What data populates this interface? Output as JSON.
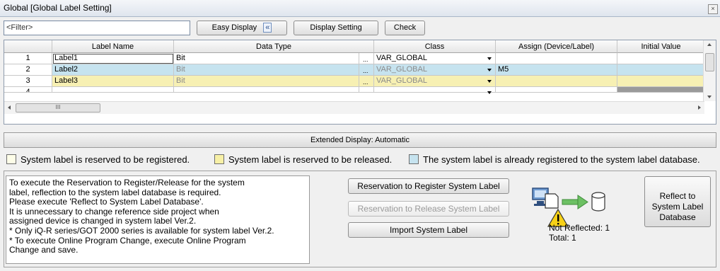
{
  "window": {
    "title": "Global [Global Label Setting]",
    "close_glyph": "×"
  },
  "toolbar": {
    "filter_placeholder": "<Filter>",
    "easy_display_label": "Easy Display",
    "easy_display_icon": "«",
    "display_setting_label": "Display Setting",
    "check_label": "Check"
  },
  "table": {
    "columns": [
      "Label Name",
      "Data Type",
      "Class",
      "Assign (Device/Label)",
      "Initial Value"
    ],
    "rows": [
      {
        "num": "1",
        "label": "Label1",
        "datatype": "Bit",
        "ellipsis": "...",
        "class": "VAR_GLOBAL",
        "assign": "",
        "initial": "",
        "color": "#ffffff",
        "dim": false
      },
      {
        "num": "2",
        "label": "Label2",
        "datatype": "Bit",
        "ellipsis": "...",
        "class": "VAR_GLOBAL",
        "assign": "M5",
        "initial": "",
        "color": "#c6e3ef",
        "dim": true
      },
      {
        "num": "3",
        "label": "Label3",
        "datatype": "Bit",
        "ellipsis": "...",
        "class": "VAR_GLOBAL",
        "assign": "",
        "initial": "",
        "color": "#f7f0b3",
        "dim": true
      },
      {
        "num": "4",
        "label": "",
        "datatype": "",
        "ellipsis": "",
        "class": "",
        "assign": "",
        "initial": "",
        "color": "#ffffff",
        "dim": false
      }
    ],
    "hscroll_thumb_glyph": "III"
  },
  "extended_display": "Extended Display: Automatic",
  "legend": {
    "reserved_register": {
      "text": "System label is reserved to be registered.",
      "color": "#fdfde8"
    },
    "reserved_release": {
      "text": "System label is reserved to be released.",
      "color": "#f7f0a6"
    },
    "registered": {
      "text": "The system label is already registered to the system label database.",
      "color": "#c6e3ef"
    }
  },
  "message": [
    "To execute the Reservation to Register/Release for the system",
    "label, reflection to the system label database is required.",
    "Please execute 'Reflect to System Label Database'.",
    "It is unnecessary to change reference side project when",
    "assigned device is changed in system label Ver.2.",
    "* Only iQ-R series/GOT 2000 series is available for system label Ver.2.",
    "* To execute Online Program Change, execute Online Program",
    "Change and save."
  ],
  "actions": {
    "register_label": "Reservation to Register System Label",
    "release_label": "Reservation to Release System Label",
    "import_label": "Import System Label",
    "reflect_label_1": "Reflect to",
    "reflect_label_2": "System Label",
    "reflect_label_3": "Database"
  },
  "status": {
    "not_reflected": "Not Reflected: 1",
    "total": "Total: 1"
  }
}
